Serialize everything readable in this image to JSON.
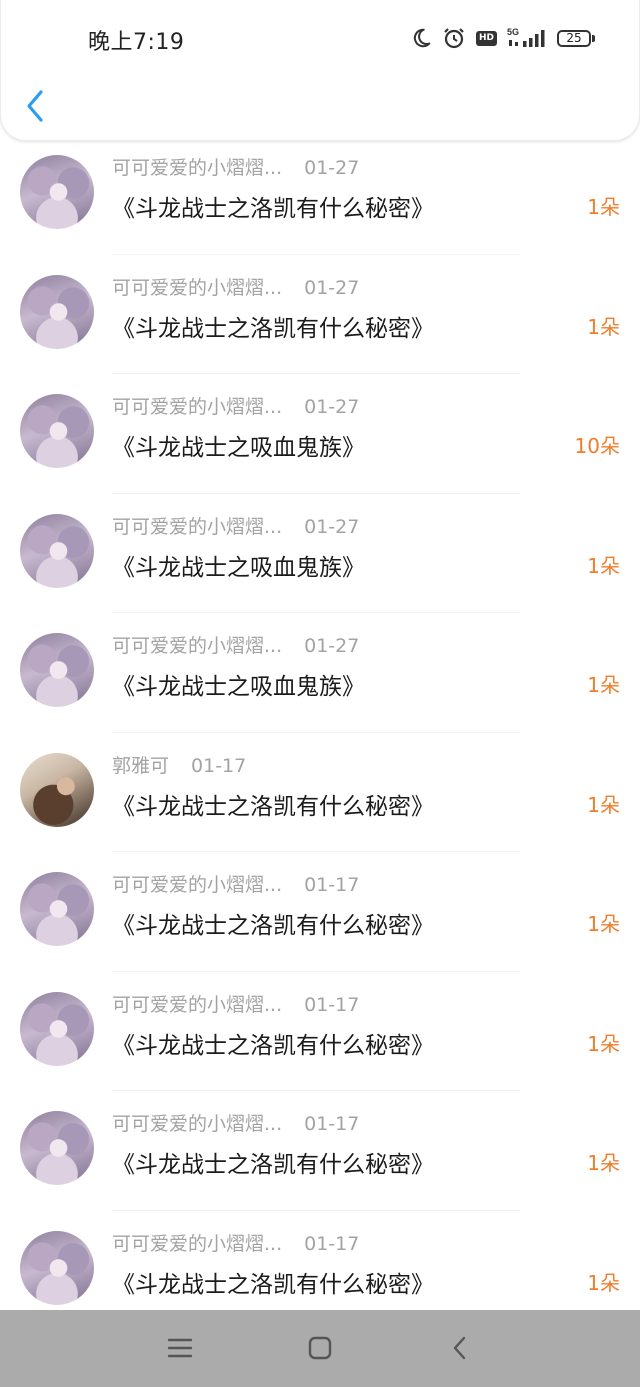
{
  "status_bar": {
    "time": "晚上7:19",
    "icons": [
      "moon-icon",
      "alarm-icon",
      "hd-icon",
      "signal-5g-icon",
      "battery-icon"
    ],
    "hd_label": "HD",
    "network_label": "5G",
    "battery_level": "25"
  },
  "header": {
    "back_icon": "chevron-left-icon"
  },
  "list": {
    "items": [
      {
        "user": "可可爱爱的小熠熠...",
        "date": "01-27",
        "title": "《斗龙战士之洛凯有什么秘密》",
        "count": "1朵",
        "avatar": "anime"
      },
      {
        "user": "可可爱爱的小熠熠...",
        "date": "01-27",
        "title": "《斗龙战士之洛凯有什么秘密》",
        "count": "1朵",
        "avatar": "anime"
      },
      {
        "user": "可可爱爱的小熠熠...",
        "date": "01-27",
        "title": "《斗龙战士之吸血鬼族》",
        "count": "10朵",
        "avatar": "anime"
      },
      {
        "user": "可可爱爱的小熠熠...",
        "date": "01-27",
        "title": "《斗龙战士之吸血鬼族》",
        "count": "1朵",
        "avatar": "anime"
      },
      {
        "user": "可可爱爱的小熠熠...",
        "date": "01-27",
        "title": "《斗龙战士之吸血鬼族》",
        "count": "1朵",
        "avatar": "anime"
      },
      {
        "user": "郭雅可",
        "date": "01-17",
        "title": "《斗龙战士之洛凯有什么秘密》",
        "count": "1朵",
        "avatar": "photo"
      },
      {
        "user": "可可爱爱的小熠熠...",
        "date": "01-17",
        "title": "《斗龙战士之洛凯有什么秘密》",
        "count": "1朵",
        "avatar": "anime"
      },
      {
        "user": "可可爱爱的小熠熠...",
        "date": "01-17",
        "title": "《斗龙战士之洛凯有什么秘密》",
        "count": "1朵",
        "avatar": "anime"
      },
      {
        "user": "可可爱爱的小熠熠...",
        "date": "01-17",
        "title": "《斗龙战士之洛凯有什么秘密》",
        "count": "1朵",
        "avatar": "anime"
      },
      {
        "user": "可可爱爱的小熠熠...",
        "date": "01-17",
        "title": "《斗龙战士之洛凯有什么秘密》",
        "count": "1朵",
        "avatar": "anime"
      }
    ]
  },
  "nav_bar": {
    "buttons": [
      "menu-icon",
      "home-square-icon",
      "back-triangle-icon"
    ]
  },
  "colors": {
    "accent_back": "#2a9cf3",
    "count": "#f07d2b",
    "meta_text": "#a3a3a3",
    "nav_bg": "#ababab"
  }
}
